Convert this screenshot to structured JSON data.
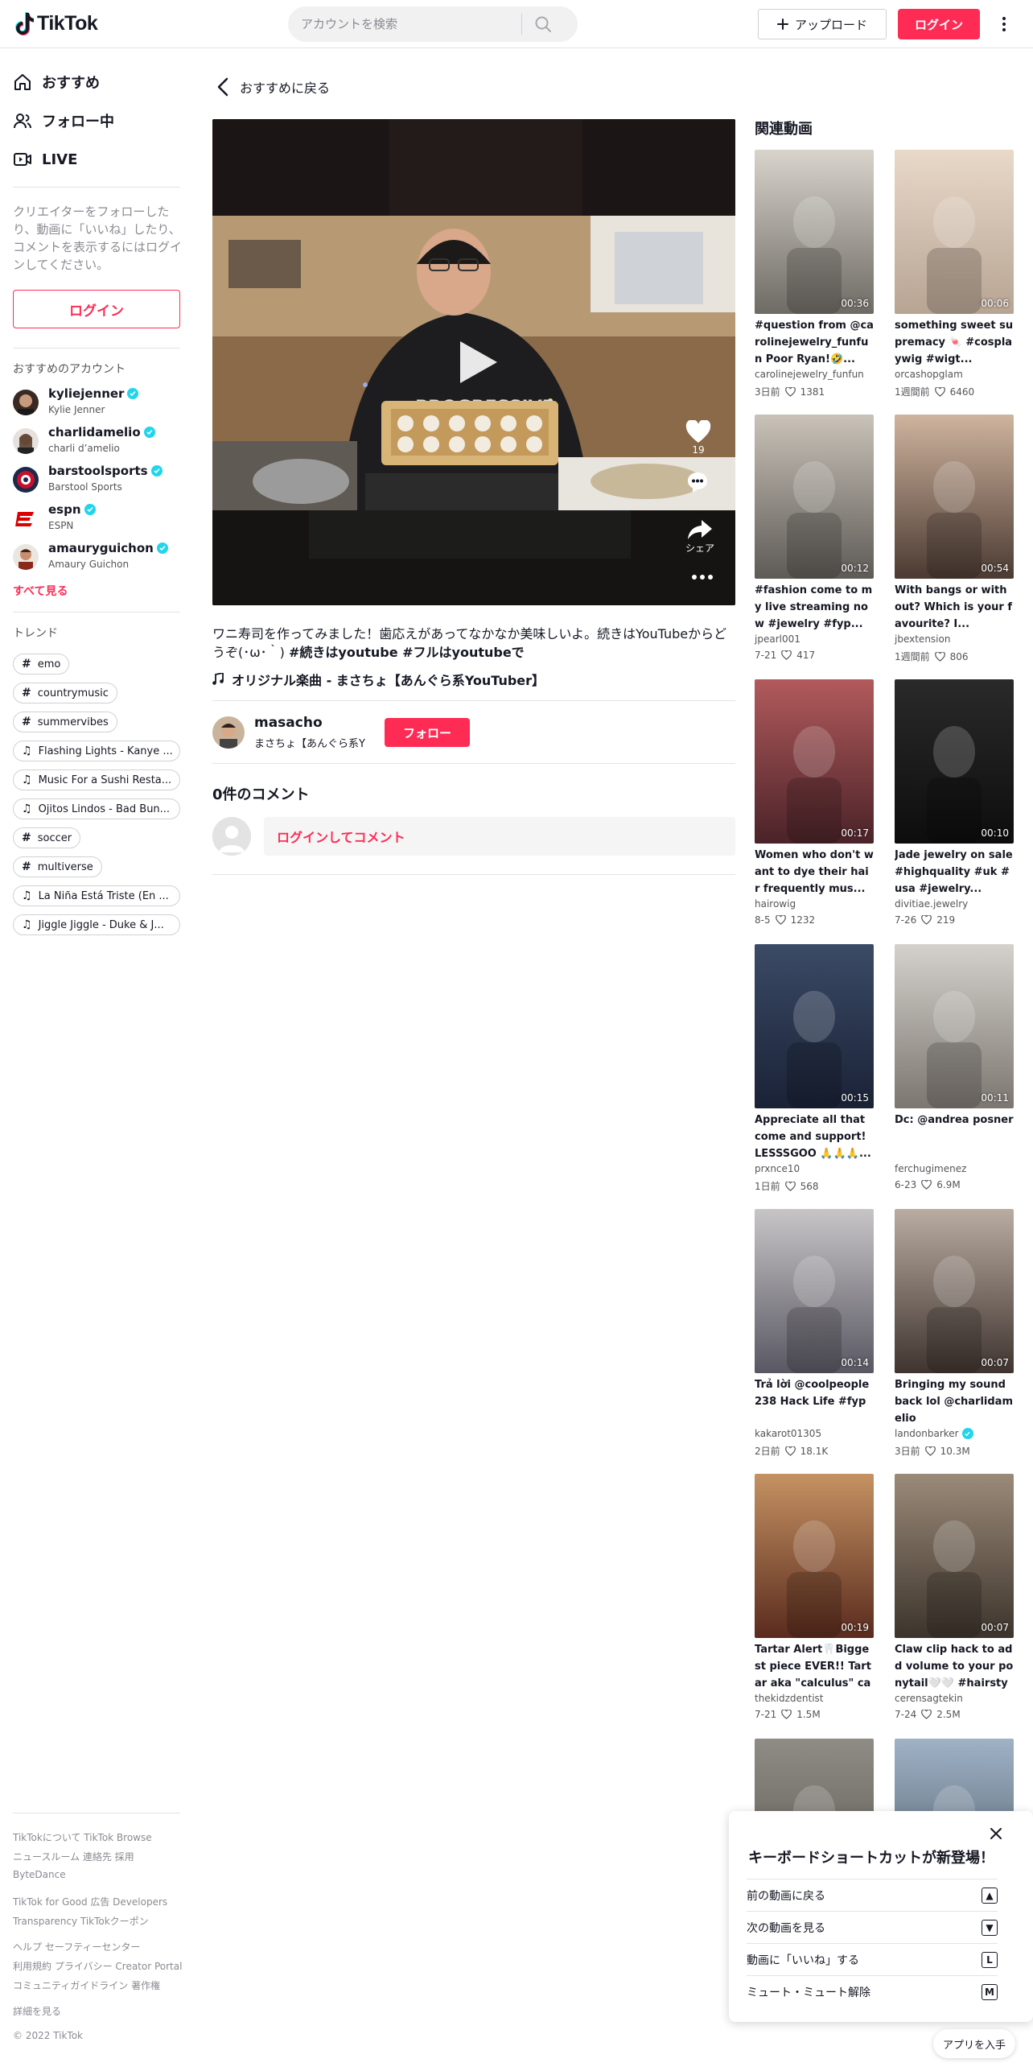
{
  "header": {
    "logo_text": "TikTok",
    "search_placeholder": "アカウントを検索",
    "upload_label": "アップロード",
    "login_label": "ログイン"
  },
  "sidebar": {
    "nav": [
      {
        "label": "おすすめ",
        "icon": "home-icon"
      },
      {
        "label": "フォロー中",
        "icon": "people-icon"
      },
      {
        "label": "LIVE",
        "icon": "live-icon"
      }
    ],
    "login_note": "クリエイターをフォローしたり、動画に「いいね」したり、コメントを表示するにはログインしてください。",
    "login_label": "ログイン",
    "suggested_title": "おすすめのアカウント",
    "accounts": [
      {
        "username": "kyliejenner",
        "nickname": "Kylie Jenner"
      },
      {
        "username": "charlidamelio",
        "nickname": "charli d’amelio"
      },
      {
        "username": "barstoolsports",
        "nickname": "Barstool Sports"
      },
      {
        "username": "espn",
        "nickname": "ESPN"
      },
      {
        "username": "amauryguichon",
        "nickname": "Amaury Guichon"
      }
    ],
    "see_all": "すべて見る",
    "trend_title": "トレンド",
    "trends": [
      {
        "type": "hashtag",
        "label": "emo"
      },
      {
        "type": "hashtag",
        "label": "countrymusic"
      },
      {
        "type": "hashtag",
        "label": "summervibes"
      },
      {
        "type": "music",
        "label": "Flashing Lights - Kanye ..."
      },
      {
        "type": "music",
        "label": "Music For a Sushi Resta..."
      },
      {
        "type": "music",
        "label": "Ojitos Lindos - Bad Bun..."
      },
      {
        "type": "hashtag",
        "label": "soccer"
      },
      {
        "type": "hashtag",
        "label": "multiverse"
      },
      {
        "type": "music",
        "label": "La Niña Está Triste (En ..."
      },
      {
        "type": "music",
        "label": "Jiggle Jiggle - Duke & J..."
      }
    ],
    "footer": [
      "TikTokについて  TikTok Browse",
      "ニュースルーム  連絡先  採用",
      "ByteDance",
      "TikTok for Good  広告  Developers",
      "Transparency  TikTokクーポン",
      "ヘルプ  セーフティーセンター",
      "利用規約  プライバシー  Creator Portal",
      "コミュニティガイドライン  著作権",
      "詳細を見る",
      "© 2022 TikTok"
    ]
  },
  "main": {
    "back_label": "おすすめに戻る",
    "likes": "19",
    "share_label": "シェア",
    "description_plain": "ワニ寿司を作ってみました！歯応えがあってなかなか美味しいよ。続きはYouTubeからどうぞ(･ω･｀) ",
    "description_tags": "#続きはyoutube #フルはyoutubeで",
    "music": "オリジナル楽曲 - まさちょ【あんぐら系YouTuber】",
    "author_username": "masacho",
    "author_nickname": "まさちょ【あんぐら系Y",
    "follow_label": "フォロー",
    "comments_title": "0件のコメント",
    "comment_login": "ログインしてコメント"
  },
  "related": {
    "title": "関連動画",
    "videos": [
      {
        "duration": "00:36",
        "title": "#question from @carolinejewelry_funfun Poor Ryan!🤣...",
        "user": "carolinejewelry_funfun",
        "verified": false,
        "age": "3日前",
        "likes": "1381",
        "colors": [
          "#d8d4cc",
          "#6e6a64"
        ]
      },
      {
        "duration": "00:06",
        "title": "something sweet supremacy 🍬 #cosplaywig #wigt...",
        "user": "orcashopglam",
        "verified": false,
        "age": "1週間前",
        "likes": "6460",
        "colors": [
          "#e9d9c9",
          "#b7a493"
        ]
      },
      {
        "duration": "00:12",
        "title": "#fashion come to my live streaming now #jewelry #fyp...",
        "user": "jpearl001",
        "verified": false,
        "age": "7-21",
        "likes": "417",
        "colors": [
          "#c9c2b8",
          "#5e5a56"
        ]
      },
      {
        "duration": "00:54",
        "title": "With bangs or without? Which is your favourite? I...",
        "user": "jbextension",
        "verified": false,
        "age": "1週間前",
        "likes": "806",
        "colors": [
          "#cfb49e",
          "#4b3a32"
        ]
      },
      {
        "duration": "00:17",
        "title": "Women who don't want to dye their hair frequently mus...",
        "user": "hairowig",
        "verified": false,
        "age": "8-5",
        "likes": "1232",
        "colors": [
          "#b25a5c",
          "#4a2328"
        ]
      },
      {
        "duration": "00:10",
        "title": "Jade jewelry on sale#highquality #uk #usa #jewelry...",
        "user": "divitiae.jewelry",
        "verified": false,
        "age": "7-26",
        "likes": "219",
        "colors": [
          "#2a2a2a",
          "#0d0d0d"
        ]
      },
      {
        "duration": "00:15",
        "title": "Appreciate all that come and support! LESSSGOO 🙏🙏🙏...",
        "user": "prxnce10",
        "verified": false,
        "age": "1日前",
        "likes": "568",
        "colors": [
          "#3b4a66",
          "#1a2236"
        ]
      },
      {
        "duration": "00:11",
        "title": "Dc: @andrea posner",
        "user": "ferchugimenez",
        "verified": false,
        "age": "6-23",
        "likes": "6.9M",
        "colors": [
          "#d4d1cc",
          "#7c7670"
        ]
      },
      {
        "duration": "00:14",
        "title": "Trả lời @coolpeople238 Hack Life #fyp",
        "user": "kakarot01305",
        "verified": false,
        "age": "2日前",
        "likes": "18.1K",
        "colors": [
          "#c7c5c6",
          "#595762"
        ]
      },
      {
        "duration": "00:07",
        "title": "Bringing my sound back lol @charlidamelio",
        "user": "landonbarker",
        "verified": true,
        "age": "3日前",
        "likes": "10.3M",
        "colors": [
          "#b9aca1",
          "#3f342f"
        ]
      },
      {
        "duration": "00:19",
        "title": "Tartar Alert🦷Biggest piece EVER!! Tartar aka \"calculus\" can...",
        "user": "thekidzdentist",
        "verified": false,
        "age": "7-21",
        "likes": "1.5M",
        "colors": [
          "#c59262",
          "#5a2b1e"
        ]
      },
      {
        "duration": "00:07",
        "title": "Claw clip hack to add volume to your ponytail🤍🤍 #hairstyl...",
        "user": "cerensagtekin",
        "verified": false,
        "age": "7-24",
        "likes": "2.5M",
        "colors": [
          "#9b8a78",
          "#3c342c"
        ]
      },
      {
        "duration": "",
        "title": "",
        "user": "",
        "verified": false,
        "age": "",
        "likes": "",
        "colors": [
          "#8f8c86",
          "#5a5650"
        ]
      },
      {
        "duration": "",
        "title": "",
        "user": "",
        "verified": false,
        "age": "",
        "likes": "",
        "colors": [
          "#9fb2c6",
          "#4d5a66"
        ]
      }
    ]
  },
  "shortcuts": {
    "title": "キーボードショートカットが新登場！",
    "items": [
      {
        "label": "前の動画に戻る",
        "key": "▲"
      },
      {
        "label": "次の動画を見る",
        "key": "▼"
      },
      {
        "label": "動画に「いいね」する",
        "key": "L"
      },
      {
        "label": "ミュート・ミュート解除",
        "key": "M"
      }
    ]
  },
  "get_app": "アプリを入手",
  "colors": {
    "brand": "#fe2c55",
    "verified": "#20d5ec",
    "text": "#161823",
    "muted": "#8a8b91"
  }
}
